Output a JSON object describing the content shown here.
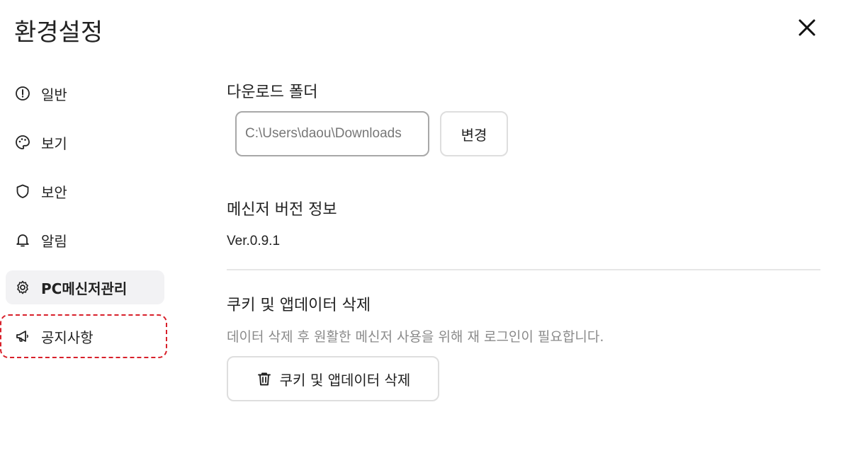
{
  "header": {
    "title": "환경설정",
    "close_icon": "close-icon"
  },
  "sidebar": {
    "items": [
      {
        "label": "일반",
        "icon": "info-circle-icon"
      },
      {
        "label": "보기",
        "icon": "palette-icon"
      },
      {
        "label": "보안",
        "icon": "shield-icon"
      },
      {
        "label": "알림",
        "icon": "bell-icon"
      },
      {
        "label": "PC메신저관리",
        "icon": "gear-icon",
        "active": true
      },
      {
        "label": "공지사항",
        "icon": "megaphone-icon",
        "highlighted": true
      }
    ]
  },
  "main": {
    "download": {
      "title": "다운로드 폴더",
      "path": "C:\\Users\\daou\\Downloads",
      "change_label": "변경"
    },
    "version": {
      "title": "메신저 버전 정보",
      "value": "Ver.0.9.1"
    },
    "cookies": {
      "title": "쿠키 및 앱데이터 삭제",
      "description": "데이터 삭제 후 원활한 메신저 사용을 위해 재 로그인이 필요합니다.",
      "button_label": "쿠키 및 앱데이터 삭제",
      "button_icon": "trash-icon"
    }
  },
  "colors": {
    "highlight_border": "#d8202a",
    "active_bg": "#f2f2f4"
  }
}
